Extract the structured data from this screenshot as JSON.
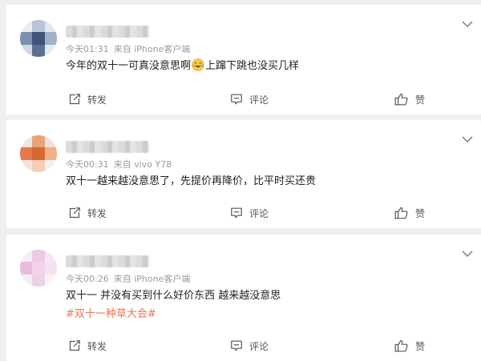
{
  "feed": {
    "posts": [
      {
        "time": "今天01:31",
        "source": "来自 iPhone客户端",
        "text_before_emoji": "今年的双十一可真没意思啊",
        "emoji": "crying-laughing-emoji",
        "text_after_emoji": "上蹿下跳也没买几样",
        "hashtag": "",
        "avatar_colors": [
          "#e9edf3",
          "#b8c4d8",
          "#dfe6ef",
          "#7d8fad",
          "#3f5478",
          "#9fb0c8",
          "#cfd8e4",
          "#5b6f92",
          "#e6ebf1"
        ]
      },
      {
        "time": "今天00:31",
        "source": "来自 vivo Y78",
        "text": "双十一越来越没意思了，先提价再降价，比平时买还贵",
        "hashtag": "",
        "avatar_colors": [
          "#f3e6df",
          "#e9a27e",
          "#f2ddd0",
          "#e47a4c",
          "#d6692f",
          "#f0b08c",
          "#efe3db",
          "#f3cdb7",
          "#f7efe9"
        ]
      },
      {
        "time": "今天00:26",
        "source": "来自 iPhone客户端",
        "text": "双十一 并没有买到什么好价东西 越来越没意思",
        "hashtag": "#双十一种草大会#",
        "avatar_colors": [
          "#f6eef5",
          "#edc9e3",
          "#f5e7f2",
          "#e8bddb",
          "#f1d3ea",
          "#f3e1ef",
          "#f7eef5",
          "#ecd2e6",
          "#f8f1f7"
        ]
      }
    ],
    "actions": {
      "repost_label": "转发",
      "comment_label": "评论",
      "like_label": "赞"
    },
    "colors": {
      "hashtag": "#eb7350",
      "meta_text": "#9a9a9a",
      "body_text": "#222222",
      "background": "#efefef"
    },
    "icons": [
      "chevron-down-icon",
      "repost-icon",
      "comment-icon",
      "like-icon"
    ]
  }
}
